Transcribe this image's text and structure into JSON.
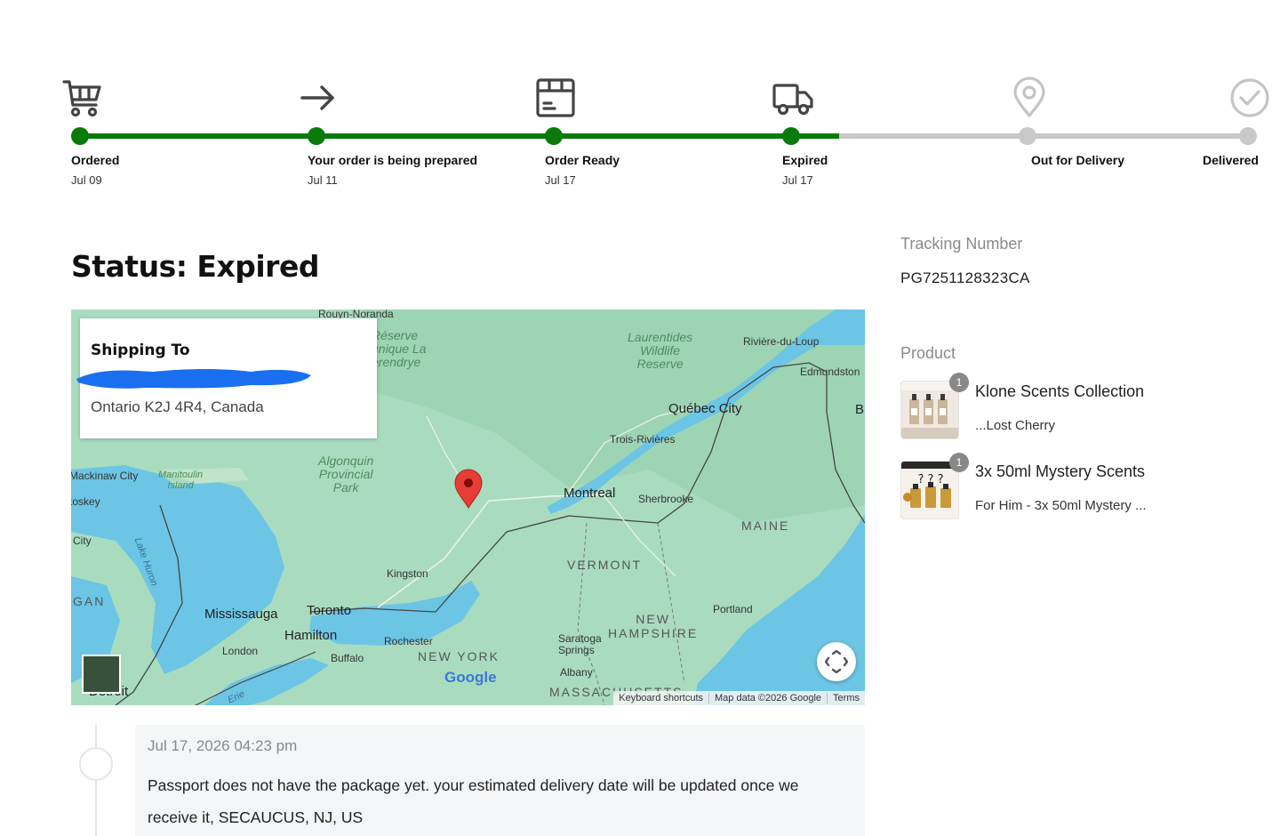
{
  "tracker": {
    "progress_percent": 65,
    "steps": [
      {
        "label": "Ordered",
        "date": "Jul 09",
        "done": true,
        "icon": "cart-icon"
      },
      {
        "label": "Your order is being prepared",
        "date": "Jul 11",
        "done": true,
        "icon": "arrow-right-icon"
      },
      {
        "label": "Order Ready",
        "date": "Jul 17",
        "done": true,
        "icon": "package-icon"
      },
      {
        "label": "Expired",
        "date": "Jul 17",
        "done": true,
        "icon": "truck-icon"
      },
      {
        "label": "Out for Delivery",
        "date": "",
        "done": false,
        "icon": "map-pin-icon"
      },
      {
        "label": "Delivered",
        "date": "",
        "done": false,
        "icon": "check-circle-icon"
      }
    ],
    "colors": {
      "done": "#0a7a0a",
      "todo": "#c8c8c8"
    }
  },
  "status": {
    "title": "Status: Expired"
  },
  "tracking": {
    "heading": "Tracking Number",
    "number": "PG7251128323CA"
  },
  "products": {
    "heading": "Product",
    "items": [
      {
        "name": "Klone Scents Collection",
        "variant": "...Lost Cherry",
        "quantity": "1"
      },
      {
        "name": "3x 50ml Mystery Scents",
        "variant": "For Him - 3x 50ml Mystery ...",
        "quantity": "1"
      }
    ]
  },
  "shipping": {
    "title": "Shipping To",
    "address": "Ontario K2J 4R4, Canada"
  },
  "map": {
    "labels": {
      "rouyn": "Rouyn-Noranda",
      "reserve": "Réserve\nunique La\nérendrye",
      "laurentides": "Laurentides\nWildlife\nReserve",
      "riviere": "Rivière-du-Loup",
      "edmundston": "Edmundston",
      "quebec": "Québec City",
      "trois": "Trois-Rivières",
      "algonquin": "Algonquin\nProvincial\nPark",
      "montreal": "Montreal",
      "sherbrooke": "Sherbrooke",
      "mackinaw": "Mackinaw City",
      "manitoulin": "Manitoulin\nIsland",
      "toskey": "toskey",
      "city": "City",
      "lake_huron": "Lake Huron",
      "maine": "MAINE",
      "vermont": "VERMONT",
      "kingston": "Kingston",
      "gan": "GAN",
      "mississauga": "Mississauga",
      "toronto": "Toronto",
      "hamilton": "Hamilton",
      "portland": "Portland",
      "new_hampshire": "NEW\nHAMPSHIRE",
      "london": "London",
      "rochester": "Rochester",
      "saratoga": "Saratoga\nSprings",
      "buffalo": "Buffalo",
      "new_york": "NEW YORK",
      "albany": "Albany",
      "detroit": "Detroit",
      "massachusetts": "MASSACHUSETTS",
      "b": "B",
      "erie": "Erie"
    },
    "google": "Google",
    "attribution": {
      "shortcuts": "Keyboard shortcuts",
      "data": "Map data ©2026 Google",
      "terms": "Terms"
    }
  },
  "timeline": {
    "events": [
      {
        "time": "Jul 17, 2026 04:23 pm",
        "message": "Passport does not have the package yet. your estimated delivery date will be updated once we receive it, SECAUCUS, NJ, US"
      }
    ]
  }
}
